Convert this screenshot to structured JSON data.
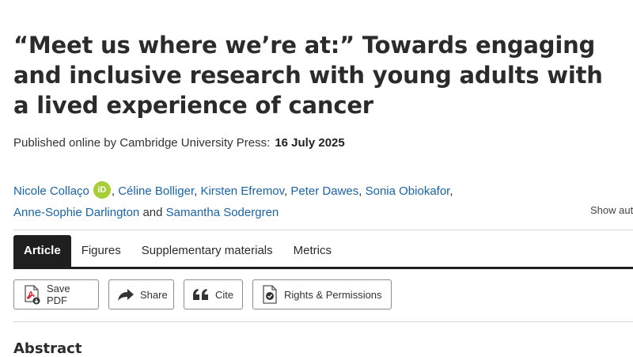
{
  "article": {
    "title": "“Meet us where we’re at:” Towards engaging and inclusive research with young adults with a lived experience of cancer",
    "published_label": "Published online by Cambridge University Press:",
    "published_date": "16 July 2025"
  },
  "authors": {
    "list": [
      "Nicole Collaço",
      "Céline Bolliger",
      "Kirsten Efremov",
      "Peter Dawes",
      "Sonia Obiokafor",
      "Anne-Sophie Darlington",
      "Samantha Sodergren"
    ],
    "and_text": "and",
    "orcid_badge": "iD",
    "show_all": "Show aut"
  },
  "tabs": [
    {
      "label": "Article",
      "active": true
    },
    {
      "label": "Figures",
      "active": false
    },
    {
      "label": "Supplementary materials",
      "active": false
    },
    {
      "label": "Metrics",
      "active": false
    }
  ],
  "actions": {
    "save_pdf": "Save PDF",
    "share": "Share",
    "cite": "Cite",
    "rights": "Rights & Permissions"
  },
  "sections": {
    "abstract_heading": "Abstract"
  },
  "colors": {
    "link": "#1a64a6",
    "orcid": "#a6ce39",
    "tab_active": "#1f1f1f",
    "pdf_red": "#d9232e"
  },
  "icons": [
    "orcid-icon",
    "pdf-icon",
    "share-icon",
    "quote-icon",
    "permissions-icon"
  ]
}
